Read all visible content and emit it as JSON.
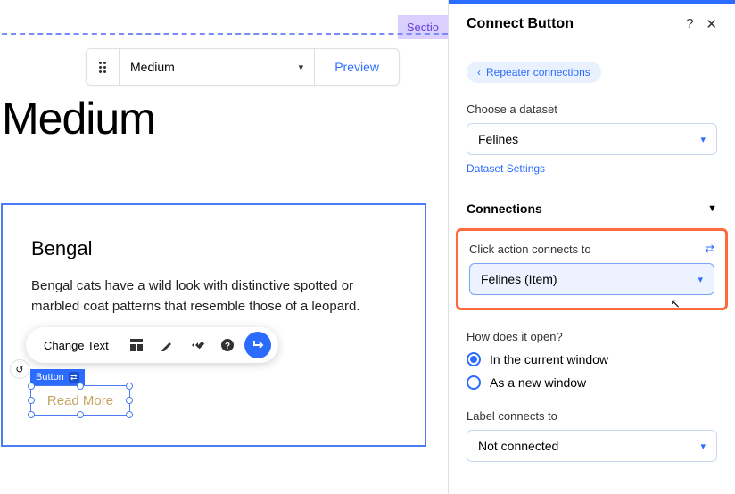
{
  "canvas": {
    "section_tag": "Sectio",
    "size_label": "Medium",
    "preview_label": "Preview",
    "page_title": "Medium",
    "card": {
      "title": "Bengal",
      "body": "Bengal cats have a wild look with distinctive spotted or marbled coat patterns that resemble those of a leopard."
    },
    "toolbar": {
      "change_text": "Change Text"
    },
    "selection": {
      "tag": "Button",
      "button_text": "Read More"
    }
  },
  "panel": {
    "title": "Connect Button",
    "back_label": "Repeater connections",
    "dataset": {
      "label": "Choose a dataset",
      "value": "Felines",
      "settings_link": "Dataset Settings"
    },
    "connections_header": "Connections",
    "click_action": {
      "label": "Click action connects to",
      "value": "Felines (Item)"
    },
    "open": {
      "label": "How does it open?",
      "options": [
        "In the current window",
        "As a new window"
      ],
      "selected": 0
    },
    "label_connects": {
      "label": "Label connects to",
      "value": "Not connected"
    }
  }
}
